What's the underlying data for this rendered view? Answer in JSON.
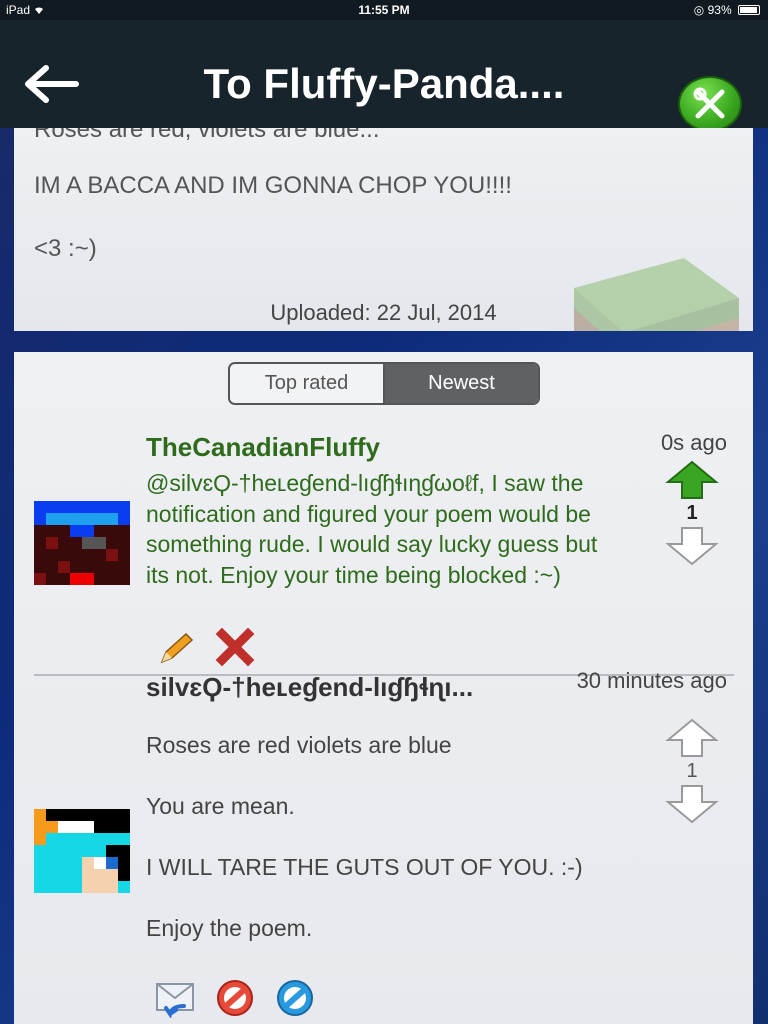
{
  "status_bar": {
    "device": "iPad",
    "wifi_icon": "wifi-icon",
    "time": "11:55 PM",
    "battery": "93%"
  },
  "nav": {
    "back_icon": "left-arrow-icon",
    "title": "To Fluffy-Panda....",
    "tools_icon": "tools-icon"
  },
  "post": {
    "cut_line": "Roses are red, violets are blue...",
    "line1": "IM A BACCA AND IM GONNA CHOP YOU!!!!",
    "line2": "<3 :~)",
    "uploaded": "Uploaded: 22 Jul, 2014"
  },
  "tabs": [
    {
      "label": "Top rated",
      "active": false
    },
    {
      "label": "Newest",
      "active": true
    }
  ],
  "comments": [
    {
      "author": "TheCanadianFluffy",
      "time": "0s ago",
      "text": "@silvɛϘ-†heʟeɠend-lıɠɧɬıɳɠωoℓf, I saw the notification and figured your poem would be something rude. I would say lucky guess but its not. Enjoy your time being blocked :~)",
      "votes": "1",
      "upvoted": true,
      "actions": [
        "pencil-icon",
        "delete-x-icon"
      ],
      "author_color": "#2e6b1a"
    },
    {
      "author": "silvɛϘ-†heʟeɠend-lıɠɧɬɳı...",
      "time": "30 minutes ago",
      "text": "Roses are red violets are blue\n\nYou are mean.\n\nI WILL TARE THE GUTS OUT OF YOU. :-)\n\nEnjoy the poem.",
      "votes": "1",
      "upvoted": false,
      "actions": [
        "reply-mail-icon",
        "block-icon",
        "report-icon"
      ]
    }
  ],
  "colors": {
    "nav_bg": "#17242b",
    "accent_green": "#3caa22",
    "background": "#0d2b7a"
  }
}
